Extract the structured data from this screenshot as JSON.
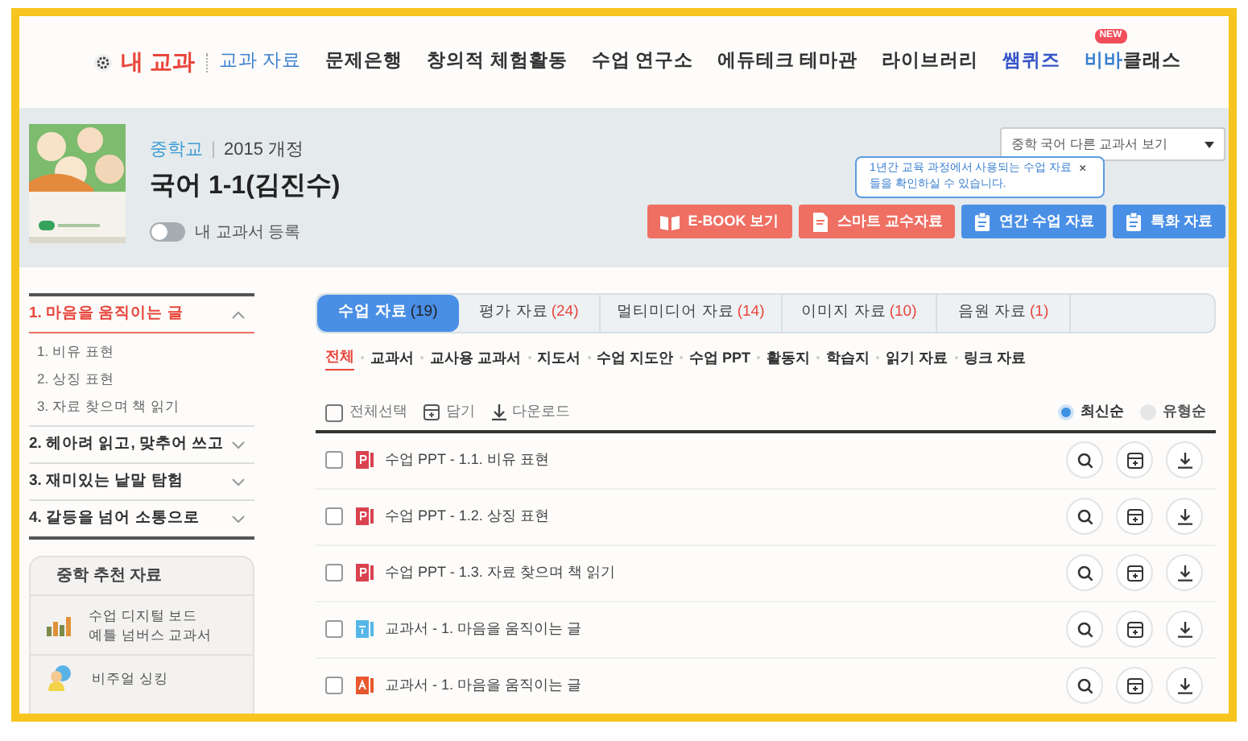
{
  "nav": {
    "home": "내 교과",
    "items": [
      {
        "label": "교과 자료",
        "selected": true,
        "kind": "text"
      },
      {
        "label": "문제은행",
        "selected": false,
        "kind": "text"
      },
      {
        "label": "창의적 체험활동",
        "selected": false,
        "kind": "text"
      },
      {
        "label": "수업 연구소",
        "selected": false,
        "kind": "text"
      },
      {
        "label": "에듀테크 테마관",
        "selected": false,
        "kind": "text"
      },
      {
        "label": "라이브러리",
        "selected": false,
        "kind": "text"
      },
      {
        "label": "쌤퀴즈",
        "selected": false,
        "kind": "brand"
      },
      {
        "label": "클래스",
        "brand_part": "비바",
        "badge": "NEW",
        "selected": false,
        "kind": "new"
      }
    ]
  },
  "book": {
    "school": "중학교",
    "edition": "2015 개정",
    "title": "국어 1-1(김진수)",
    "register": {
      "label": "내 교과서 등록",
      "on": false
    }
  },
  "other_books": {
    "value": "중학 국어 다른 교과서 보기"
  },
  "tooltip": {
    "text": "1년간 교육 과정에서 사용되는 수업 자료들을 확인하실 수 있습니다.",
    "close": "×"
  },
  "actions": [
    {
      "label": "E-BOOK 보기",
      "kind": "book",
      "color": "#ef6f63"
    },
    {
      "label": "스마트 교수자료",
      "kind": "doc",
      "color": "#ef6f63"
    },
    {
      "label": "연간 수업 자료",
      "kind": "clipboard",
      "color": "#4a8fe6"
    },
    {
      "label": "특화 자료",
      "kind": "clipboard",
      "color": "#4a8fe6"
    }
  ],
  "sidebar": {
    "units": [
      {
        "label": "1. 마음을 움직이는 글",
        "expanded": true,
        "children": [
          {
            "label": "1. 비유 표현"
          },
          {
            "label": "2. 상징 표현"
          },
          {
            "label": "3. 자료 찾으며 책 읽기"
          }
        ]
      },
      {
        "label": "2. 헤아려 읽고, 맞추어 쓰고",
        "expanded": false
      },
      {
        "label": "3. 재미있는 낱말 탐험",
        "expanded": false
      },
      {
        "label": "4. 갈등을 넘어 소통으로",
        "expanded": false
      }
    ],
    "recommend": {
      "title": "중학 추천 자료",
      "items": [
        {
          "label": "수업 디지털 보드\n예틀 넘버스 교과서",
          "kind": "chart"
        },
        {
          "label": "비주얼 싱킹",
          "kind": "person"
        }
      ]
    }
  },
  "tabs": [
    {
      "label": "수업 자료",
      "count": "(19)",
      "selected": true
    },
    {
      "label": "평가 자료",
      "count": "(24)",
      "selected": false
    },
    {
      "label": "멀티미디어 자료",
      "count": "(14)",
      "selected": false
    },
    {
      "label": "이미지 자료",
      "count": "(10)",
      "selected": false
    },
    {
      "label": "음원 자료",
      "count": "(1)",
      "selected": false
    }
  ],
  "filters": [
    {
      "label": "전체",
      "selected": true
    },
    {
      "label": "교과서",
      "selected": false
    },
    {
      "label": "교사용 교과서",
      "selected": false
    },
    {
      "label": "지도서",
      "selected": false
    },
    {
      "label": "수업 지도안",
      "selected": false
    },
    {
      "label": "수업 PPT",
      "selected": false
    },
    {
      "label": "활동지",
      "selected": false
    },
    {
      "label": "학습지",
      "selected": false
    },
    {
      "label": "읽기 자료",
      "selected": false
    },
    {
      "label": "링크 자료",
      "selected": false
    }
  ],
  "toolbar": {
    "select_all": {
      "label": "전체선택",
      "checked": false
    },
    "save": "담기",
    "download": "다운로드",
    "sort": [
      {
        "label": "최신순",
        "selected": true
      },
      {
        "label": "유형순",
        "selected": false
      }
    ]
  },
  "rows": [
    {
      "title": "수업 PPT - 1.1. 비유 표현",
      "kind": "ppt",
      "checked": false
    },
    {
      "title": "수업 PPT - 1.2. 상징 표현",
      "kind": "ppt",
      "checked": false
    },
    {
      "title": "수업 PPT - 1.3. 자료 찾으며 책 읽기",
      "kind": "ppt",
      "checked": false
    },
    {
      "title": "교과서 - 1. 마음을 움직이는 글",
      "kind": "hwp",
      "checked": false
    },
    {
      "title": "교과서 - 1. 마음을 움직이는 글",
      "kind": "pdf",
      "checked": false
    }
  ]
}
